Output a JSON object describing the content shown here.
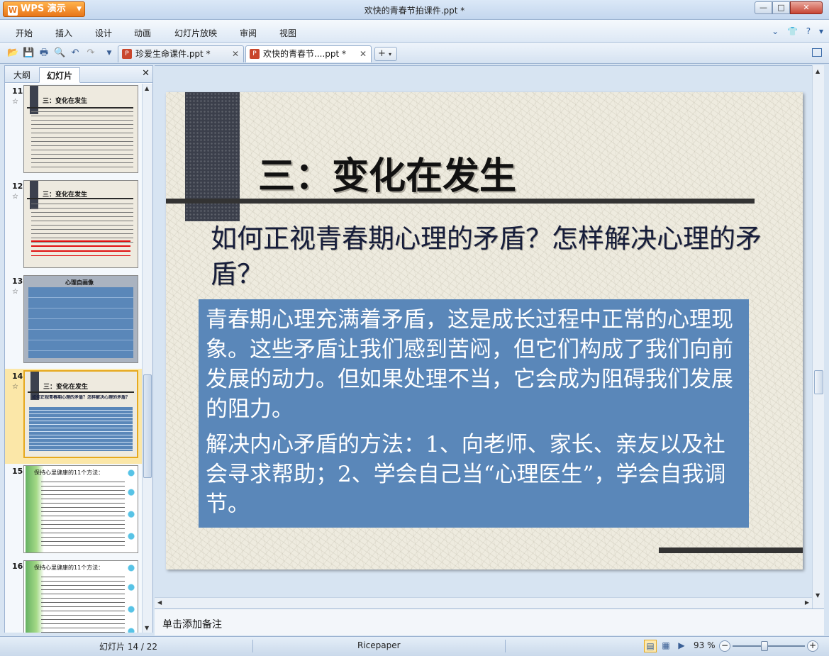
{
  "window": {
    "app_button": "WPS 演示",
    "title": "欢快的青春节拍课件.ppt *"
  },
  "menu": {
    "items": [
      "开始",
      "插入",
      "设计",
      "动画",
      "幻灯片放映",
      "审阅",
      "视图"
    ]
  },
  "tabs": [
    {
      "label": "珍爱生命课件.ppt *",
      "active": false
    },
    {
      "label": "欢快的青春节....ppt *",
      "active": true
    }
  ],
  "panel": {
    "tabs": [
      "大纲",
      "幻灯片"
    ],
    "active_tab": "幻灯片"
  },
  "thumbnails": [
    {
      "number": "11",
      "title": "三：变化在发生"
    },
    {
      "number": "12",
      "title": "三：变化在发生"
    },
    {
      "number": "13",
      "title": "心理自画像"
    },
    {
      "number": "14",
      "title": "三：变化在发生",
      "subtitle": "如何正视青春期心理的矛盾？怎样解决心理的矛盾？",
      "selected": true
    },
    {
      "number": "15",
      "title": "保持心里健康的11个方法："
    },
    {
      "number": "16",
      "title": "保持心里健康的11个方法："
    }
  ],
  "slide": {
    "title": "三：变化在发生",
    "subtitle": "如何正视青春期心理的矛盾？怎样解决心理的矛盾？",
    "paragraphs": [
      "青春期心理充满着矛盾，这是成长过程中正常的心理现象。这些矛盾让我们感到苦闷，但它们构成了我们向前发展的动力。但如果处理不当，它会成为阻碍我们发展的阻力。",
      "解决内心矛盾的方法：1、向老师、家长、亲友以及社会寻求帮助；2、学会自己当“心理医生”，学会自我调节。"
    ],
    "colors": {
      "background": "#eeebdf",
      "text_box": "#5a87b9",
      "bar": "#3b3f4b"
    }
  },
  "notes": {
    "placeholder": "单击添加备注"
  },
  "status": {
    "slide_position": "幻灯片 14 / 22",
    "theme": "Ricepaper",
    "zoom": "93 %",
    "zoom_level_percent": 93
  }
}
